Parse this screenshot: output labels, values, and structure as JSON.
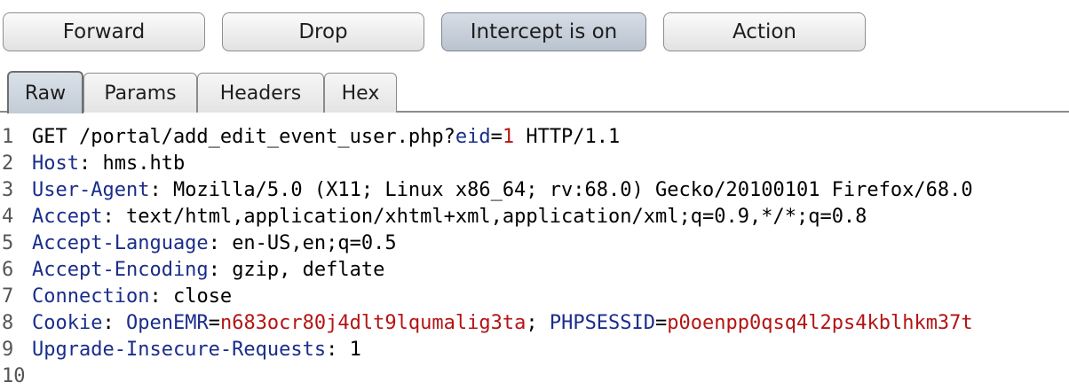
{
  "toolbar": {
    "forward_label": "Forward",
    "drop_label": "Drop",
    "intercept_label": "Intercept is on",
    "action_label": "Action"
  },
  "tabs": [
    {
      "label": "Raw",
      "active": true
    },
    {
      "label": "Params",
      "active": false
    },
    {
      "label": "Headers",
      "active": false
    },
    {
      "label": "Hex",
      "active": false
    }
  ],
  "colors": {
    "header_name": "#1a2d8a",
    "param_value": "#b41414",
    "line_number": "#555555"
  },
  "request": {
    "line_numbers": [
      "1",
      "2",
      "3",
      "4",
      "5",
      "6",
      "7",
      "8",
      "9",
      "10"
    ],
    "request_line": {
      "method_path": "GET /portal/add_edit_event_user.php?",
      "param_name": "eid",
      "eq": "=",
      "param_value": "1",
      "protocol": " HTTP/1.1"
    },
    "headers": [
      {
        "name": "Host",
        "sep": ": ",
        "value": "hms.htb"
      },
      {
        "name": "User-Agent",
        "sep": ": ",
        "value": "Mozilla/5.0 (X11; Linux x86_64; rv:68.0) Gecko/20100101 Firefox/68.0"
      },
      {
        "name": "Accept",
        "sep": ": ",
        "value": "text/html,application/xhtml+xml,application/xml;q=0.9,*/*;q=0.8"
      },
      {
        "name": "Accept-Language",
        "sep": ": ",
        "value": "en-US,en;q=0.5"
      },
      {
        "name": "Accept-Encoding",
        "sep": ": ",
        "value": "gzip, deflate"
      },
      {
        "name": "Connection",
        "sep": ": ",
        "value": "close"
      }
    ],
    "cookie": {
      "name": "Cookie",
      "sep": ": ",
      "c1_name": "OpenEMR",
      "c1_eq": "=",
      "c1_value": "n683ocr80j4dlt9lqumalig3ta",
      "semi": "; ",
      "c2_name": "PHPSESSID",
      "c2_eq": "=",
      "c2_value": "p0oenpp0qsq4l2ps4kblhkm37t"
    },
    "last_header": {
      "name": "Upgrade-Insecure-Requests",
      "sep": ": ",
      "value": "1"
    }
  }
}
